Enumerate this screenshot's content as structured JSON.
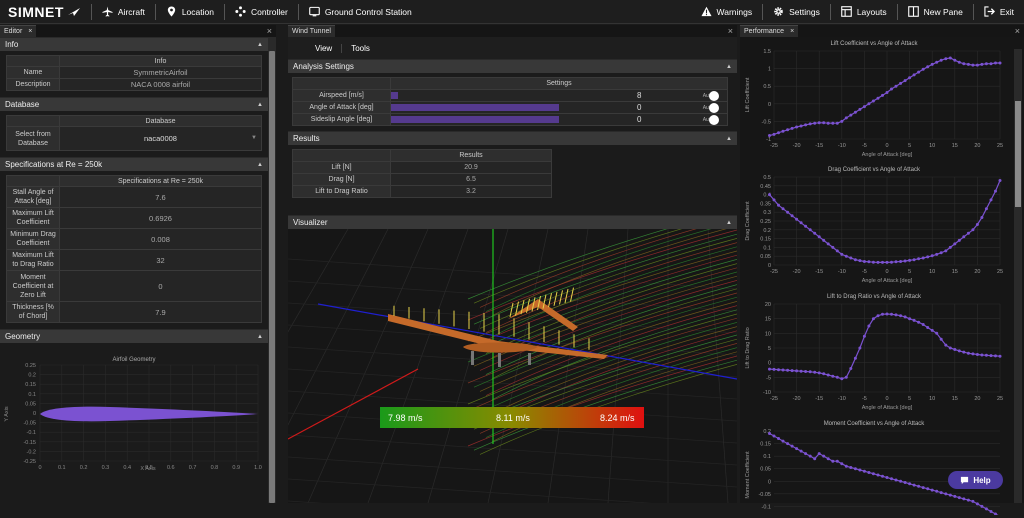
{
  "app": {
    "logo": "SIMNET"
  },
  "topnav": {
    "left": [
      {
        "label": "Aircraft",
        "icon": "airplane-icon"
      },
      {
        "label": "Location",
        "icon": "location-pin-icon"
      },
      {
        "label": "Controller",
        "icon": "gamepad-icon"
      },
      {
        "label": "Ground Control Station",
        "icon": "monitor-icon"
      }
    ],
    "right": [
      {
        "label": "Warnings",
        "icon": "warning-icon"
      },
      {
        "label": "Settings",
        "icon": "gear-icon"
      },
      {
        "label": "Layouts",
        "icon": "layout-icon"
      },
      {
        "label": "New Pane",
        "icon": "new-pane-icon"
      },
      {
        "label": "Exit",
        "icon": "exit-icon"
      }
    ]
  },
  "editor": {
    "tab": "Editor",
    "info": {
      "section": "Info",
      "header": "Info",
      "rows": [
        {
          "key": "Name",
          "value": "SymmetricAirfoil"
        },
        {
          "key": "Description",
          "value": "NACA 0008 airfoil"
        }
      ]
    },
    "database": {
      "section": "Database",
      "header": "Database",
      "key": "Select from Database",
      "value": "naca0008"
    },
    "specs": {
      "section": "Specifications at Re = 250k",
      "header": "Specifications at Re = 250k",
      "rows": [
        {
          "key": "Stall Angle of Attack [deg]",
          "value": "7.6"
        },
        {
          "key": "Maximum Lift Coefficient",
          "value": "0.6926"
        },
        {
          "key": "Minimum Drag Coefficient",
          "value": "0.008"
        },
        {
          "key": "Maximum Lift to Drag Ratio",
          "value": "32"
        },
        {
          "key": "Moment Coefficient at Zero Lift",
          "value": "0"
        },
        {
          "key": "Thickness [% of Chord]",
          "value": "7.9"
        }
      ]
    },
    "geometry": {
      "section": "Geometry",
      "chart_title": "Airfoil Geometry",
      "xlabel": "X Axis",
      "ylabel": "Y Axis",
      "xticks": [
        "0",
        "0.1",
        "0.2",
        "0.3",
        "0.4",
        "0.5",
        "0.6",
        "0.7",
        "0.8",
        "0.9",
        "1.0"
      ],
      "yticks": [
        "0.25",
        "0.2",
        "0.15",
        "0.1",
        "0.05",
        "0",
        "-0.05",
        "-0.1",
        "-0.15",
        "-0.2",
        "-0.25"
      ]
    }
  },
  "tunnel": {
    "tab": "Wind Tunnel",
    "menu": [
      "View",
      "Tools"
    ],
    "analysis": {
      "section": "Analysis Settings",
      "header": "Settings",
      "rows": [
        {
          "key": "Airspeed [m/s]",
          "value": "8",
          "fill": 0.02
        },
        {
          "key": "Angle of Attack [deg]",
          "value": "0",
          "fill": 0.5
        },
        {
          "key": "Sideslip Angle [deg]",
          "value": "0",
          "fill": 0.5
        }
      ],
      "auto_label": "Auto"
    },
    "results": {
      "section": "Results",
      "header": "Results",
      "rows": [
        {
          "key": "Lift [N]",
          "value": "20.9"
        },
        {
          "key": "Drag [N]",
          "value": "6.5"
        },
        {
          "key": "Lift to Drag Ratio",
          "value": "3.2"
        }
      ]
    },
    "visualizer": {
      "section": "Visualizer",
      "legend": [
        "7.98 m/s",
        "8.11 m/s",
        "8.24 m/s"
      ]
    }
  },
  "performance": {
    "tab": "Performance",
    "help_label": "Help"
  },
  "chart_data": [
    {
      "type": "line",
      "title": "Lift Coefficient vs Angle of Attack",
      "xlabel": "Angle of Attack [deg]",
      "ylabel": "Lift Coefficient",
      "xlim": [
        -25,
        25
      ],
      "ylim": [
        -1,
        1.5
      ],
      "yticks": [
        1.5,
        1,
        0.5,
        0,
        -0.5,
        -1
      ],
      "color": "#7b52d1",
      "x": [
        -26,
        -25,
        -24,
        -23,
        -22,
        -21,
        -20,
        -19,
        -18,
        -17,
        -16,
        -15,
        -14,
        -13,
        -12,
        -11,
        -10,
        -9,
        -8,
        -7,
        -6,
        -5,
        -4,
        -3,
        -2,
        -1,
        0,
        1,
        2,
        3,
        4,
        5,
        6,
        7,
        8,
        9,
        10,
        11,
        12,
        13,
        14,
        15,
        16,
        17,
        18,
        19,
        20,
        21,
        22,
        23,
        24,
        25
      ],
      "y": [
        -0.9,
        -0.87,
        -0.82,
        -0.78,
        -0.74,
        -0.7,
        -0.66,
        -0.63,
        -0.6,
        -0.57,
        -0.55,
        -0.54,
        -0.54,
        -0.55,
        -0.55,
        -0.55,
        -0.5,
        -0.4,
        -0.32,
        -0.24,
        -0.16,
        -0.08,
        0,
        0.08,
        0.16,
        0.24,
        0.32,
        0.42,
        0.5,
        0.58,
        0.66,
        0.74,
        0.82,
        0.9,
        0.98,
        1.05,
        1.12,
        1.18,
        1.24,
        1.28,
        1.3,
        1.24,
        1.18,
        1.14,
        1.12,
        1.1,
        1.1,
        1.12,
        1.14,
        1.14,
        1.16,
        1.16
      ]
    },
    {
      "type": "line",
      "title": "Drag Coefficient vs Angle of Attack",
      "xlabel": "Angle of Attack [deg]",
      "ylabel": "Drag Coefficient",
      "xlim": [
        -25,
        25
      ],
      "ylim": [
        0,
        0.5
      ],
      "yticks": [
        0.5,
        0.45,
        0.4,
        0.35,
        0.3,
        0.25,
        0.2,
        0.15,
        0.1,
        0.05,
        0
      ],
      "color": "#7b52d1",
      "x": [
        -26,
        -25,
        -24,
        -23,
        -22,
        -21,
        -20,
        -19,
        -18,
        -17,
        -16,
        -15,
        -14,
        -13,
        -12,
        -11,
        -10,
        -9,
        -8,
        -7,
        -6,
        -5,
        -4,
        -3,
        -2,
        -1,
        0,
        1,
        2,
        3,
        4,
        5,
        6,
        7,
        8,
        9,
        10,
        11,
        12,
        13,
        14,
        15,
        16,
        17,
        18,
        19,
        20,
        21,
        22,
        23,
        24,
        25
      ],
      "y": [
        0.4,
        0.37,
        0.34,
        0.32,
        0.3,
        0.28,
        0.26,
        0.24,
        0.22,
        0.2,
        0.18,
        0.16,
        0.14,
        0.12,
        0.1,
        0.08,
        0.06,
        0.05,
        0.04,
        0.03,
        0.025,
        0.02,
        0.018,
        0.016,
        0.015,
        0.015,
        0.015,
        0.016,
        0.018,
        0.02,
        0.023,
        0.026,
        0.03,
        0.035,
        0.04,
        0.046,
        0.052,
        0.06,
        0.07,
        0.08,
        0.1,
        0.12,
        0.14,
        0.16,
        0.18,
        0.2,
        0.23,
        0.27,
        0.32,
        0.37,
        0.42,
        0.48
      ]
    },
    {
      "type": "line",
      "title": "Lift to Drag Ratio vs Angle of Attack",
      "xlabel": "Angle of Attack [deg]",
      "ylabel": "Lift to Drag Ratio",
      "xlim": [
        -25,
        25
      ],
      "ylim": [
        -10,
        20
      ],
      "yticks": [
        20,
        15,
        10,
        5,
        0,
        -5,
        -10
      ],
      "color": "#7b52d1",
      "x": [
        -26,
        -25,
        -24,
        -23,
        -22,
        -21,
        -20,
        -19,
        -18,
        -17,
        -16,
        -15,
        -14,
        -13,
        -12,
        -11,
        -10,
        -9,
        -8,
        -7,
        -6,
        -5,
        -4,
        -3,
        -2,
        -1,
        0,
        1,
        2,
        3,
        4,
        5,
        6,
        7,
        8,
        9,
        10,
        11,
        12,
        13,
        14,
        15,
        16,
        17,
        18,
        19,
        20,
        21,
        22,
        23,
        24,
        25
      ],
      "y": [
        -2.2,
        -2.3,
        -2.4,
        -2.5,
        -2.6,
        -2.7,
        -2.8,
        -2.9,
        -3,
        -3.1,
        -3.3,
        -3.5,
        -3.8,
        -4.2,
        -4.6,
        -5,
        -5.5,
        -5,
        -2,
        1.5,
        5,
        9,
        12.5,
        15,
        16,
        16.5,
        16.6,
        16.5,
        16.3,
        16,
        15.6,
        15,
        14.4,
        13.8,
        13,
        12,
        11,
        10,
        8,
        6,
        5,
        4.5,
        4,
        3.6,
        3.2,
        3,
        2.8,
        2.6,
        2.5,
        2.4,
        2.3,
        2.2
      ]
    },
    {
      "type": "line",
      "title": "Moment Coefficient vs Angle of Attack",
      "ylabel": "Moment Coefficient",
      "xlim": [
        -25,
        25
      ],
      "ylim": [
        -0.15,
        0.2
      ],
      "yticks": [
        0.2,
        0.15,
        0.1,
        0.05,
        0,
        -0.05,
        -0.1,
        -0.15
      ],
      "color": "#7b52d1",
      "x": [
        -26,
        -25,
        -24,
        -23,
        -22,
        -21,
        -20,
        -19,
        -18,
        -17,
        -16,
        -15,
        -14,
        -13,
        -12,
        -11,
        -10,
        -9,
        -8,
        -7,
        -6,
        -5,
        -4,
        -3,
        -2,
        -1,
        0,
        1,
        2,
        3,
        4,
        5,
        6,
        7,
        8,
        9,
        10,
        11,
        12,
        13,
        14,
        15,
        16,
        17,
        18,
        19,
        20,
        21,
        22,
        23,
        24,
        25
      ],
      "y": [
        0.19,
        0.18,
        0.17,
        0.16,
        0.15,
        0.14,
        0.13,
        0.12,
        0.11,
        0.1,
        0.09,
        0.11,
        0.1,
        0.09,
        0.08,
        0.08,
        0.07,
        0.06,
        0.055,
        0.05,
        0.045,
        0.04,
        0.035,
        0.03,
        0.025,
        0.02,
        0.015,
        0.01,
        0.005,
        0,
        -0.005,
        -0.01,
        -0.015,
        -0.02,
        -0.025,
        -0.03,
        -0.035,
        -0.04,
        -0.045,
        -0.05,
        -0.055,
        -0.06,
        -0.065,
        -0.07,
        -0.075,
        -0.08,
        -0.09,
        -0.1,
        -0.11,
        -0.12,
        -0.13,
        -0.14
      ]
    }
  ]
}
